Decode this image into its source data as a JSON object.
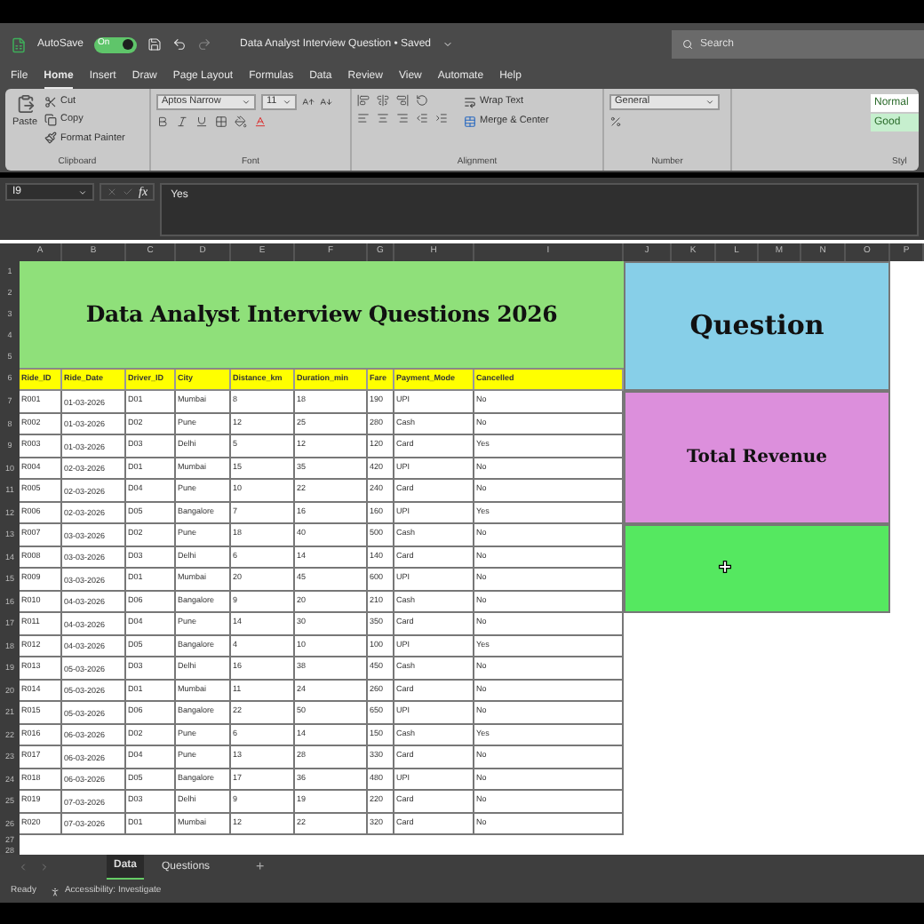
{
  "title_bar": {
    "autosave_label": "AutoSave",
    "autosave_on": true,
    "toggle_text": "On",
    "title": "Data Analyst Interview Question • Saved",
    "search_placeholder": "Search"
  },
  "menu_tabs": [
    {
      "label": "File",
      "selected": false
    },
    {
      "label": "Home",
      "selected": true
    },
    {
      "label": "Insert",
      "selected": false
    },
    {
      "label": "Draw",
      "selected": false
    },
    {
      "label": "Page Layout",
      "selected": false
    },
    {
      "label": "Formulas",
      "selected": false
    },
    {
      "label": "Data",
      "selected": false
    },
    {
      "label": "Review",
      "selected": false
    },
    {
      "label": "View",
      "selected": false
    },
    {
      "label": "Automate",
      "selected": false
    },
    {
      "label": "Help",
      "selected": false
    }
  ],
  "ribbon": {
    "clipboard": {
      "paste": "Paste",
      "cut": "Cut",
      "copy": "Copy",
      "format_painter": "Format Painter",
      "label": "Clipboard"
    },
    "font": {
      "name": "Aptos Narrow",
      "size": "11",
      "label": "Font"
    },
    "alignment": {
      "wrap_text": "Wrap Text",
      "merge_center": "Merge & Center",
      "label": "Alignment"
    },
    "number": {
      "format": "General",
      "label": "Number"
    },
    "styles": {
      "items": [
        {
          "label": "Normal",
          "color": "#ffffff"
        },
        {
          "label": "Good",
          "color": "#c6efce"
        }
      ],
      "label": "Styl"
    }
  },
  "formula_bar": {
    "name_box": "I9",
    "fx": "fx",
    "value": "Yes"
  },
  "sheet": {
    "columns": [
      "A",
      "B",
      "C",
      "D",
      "E",
      "F",
      "G",
      "H",
      "I",
      "J",
      "K",
      "L",
      "M",
      "N",
      "O",
      "P"
    ],
    "row_numbers": [
      "1",
      "2",
      "3",
      "4",
      "5",
      "6",
      "7",
      "8",
      "9",
      "10",
      "11",
      "12",
      "13",
      "14",
      "15",
      "16",
      "17",
      "18",
      "19",
      "20",
      "21",
      "22",
      "23",
      "24",
      "25",
      "26",
      "27",
      "28"
    ],
    "title": "Data Analyst Interview Questions 2026",
    "headers": [
      "Ride_ID",
      "Ride_Date",
      "Driver_ID",
      "City",
      "Distance_km",
      "Duration_min",
      "Fare",
      "Payment_Mode",
      "Cancelled"
    ],
    "rows": [
      [
        "R001",
        "01-03-2026",
        "D01",
        "Mumbai",
        "8",
        "18",
        "190",
        "UPI",
        "No"
      ],
      [
        "R002",
        "01-03-2026",
        "D02",
        "Pune",
        "12",
        "25",
        "280",
        "Cash",
        "No"
      ],
      [
        "R003",
        "01-03-2026",
        "D03",
        "Delhi",
        "5",
        "12",
        "120",
        "Card",
        "Yes"
      ],
      [
        "R004",
        "02-03-2026",
        "D01",
        "Mumbai",
        "15",
        "35",
        "420",
        "UPI",
        "No"
      ],
      [
        "R005",
        "02-03-2026",
        "D04",
        "Pune",
        "10",
        "22",
        "240",
        "Card",
        "No"
      ],
      [
        "R006",
        "02-03-2026",
        "D05",
        "Bangalore",
        "7",
        "16",
        "160",
        "UPI",
        "Yes"
      ],
      [
        "R007",
        "03-03-2026",
        "D02",
        "Pune",
        "18",
        "40",
        "500",
        "Cash",
        "No"
      ],
      [
        "R008",
        "03-03-2026",
        "D03",
        "Delhi",
        "6",
        "14",
        "140",
        "Card",
        "No"
      ],
      [
        "R009",
        "03-03-2026",
        "D01",
        "Mumbai",
        "20",
        "45",
        "600",
        "UPI",
        "No"
      ],
      [
        "R010",
        "04-03-2026",
        "D06",
        "Bangalore",
        "9",
        "20",
        "210",
        "Cash",
        "No"
      ],
      [
        "R011",
        "04-03-2026",
        "D04",
        "Pune",
        "14",
        "30",
        "350",
        "Card",
        "No"
      ],
      [
        "R012",
        "04-03-2026",
        "D05",
        "Bangalore",
        "4",
        "10",
        "100",
        "UPI",
        "Yes"
      ],
      [
        "R013",
        "05-03-2026",
        "D03",
        "Delhi",
        "16",
        "38",
        "450",
        "Cash",
        "No"
      ],
      [
        "R014",
        "05-03-2026",
        "D01",
        "Mumbai",
        "11",
        "24",
        "260",
        "Card",
        "No"
      ],
      [
        "R015",
        "05-03-2026",
        "D06",
        "Bangalore",
        "22",
        "50",
        "650",
        "UPI",
        "No"
      ],
      [
        "R016",
        "06-03-2026",
        "D02",
        "Pune",
        "6",
        "14",
        "150",
        "Cash",
        "Yes"
      ],
      [
        "R017",
        "06-03-2026",
        "D04",
        "Pune",
        "13",
        "28",
        "330",
        "Card",
        "No"
      ],
      [
        "R018",
        "06-03-2026",
        "D05",
        "Bangalore",
        "17",
        "36",
        "480",
        "UPI",
        "No"
      ],
      [
        "R019",
        "07-03-2026",
        "D03",
        "Delhi",
        "9",
        "19",
        "220",
        "Card",
        "No"
      ],
      [
        "R020",
        "07-03-2026",
        "D01",
        "Mumbai",
        "12",
        "22",
        "320",
        "Card",
        "No"
      ]
    ],
    "panels": [
      {
        "kind": "heading",
        "text": "Question",
        "color": "#87cfe8"
      },
      {
        "kind": "label",
        "text": "Total Revenue",
        "color": "#dc8fdc"
      },
      {
        "kind": "blank",
        "color": "#55e860"
      }
    ]
  },
  "sheet_tabs": [
    {
      "label": "Data",
      "selected": true
    },
    {
      "label": "Questions",
      "selected": false
    }
  ],
  "add_sheet": "+",
  "status_bar": {
    "ready": "Ready",
    "accessibility": "Accessibility: Investigate"
  }
}
